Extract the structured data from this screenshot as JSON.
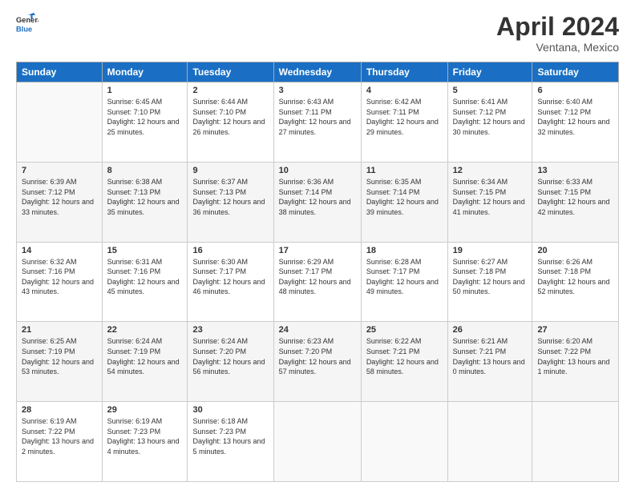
{
  "header": {
    "logo_general": "General",
    "logo_blue": "Blue",
    "month_title": "April 2024",
    "location": "Ventana, Mexico"
  },
  "weekdays": [
    "Sunday",
    "Monday",
    "Tuesday",
    "Wednesday",
    "Thursday",
    "Friday",
    "Saturday"
  ],
  "weeks": [
    [
      {
        "day": "",
        "sunrise": "",
        "sunset": "",
        "daylight": ""
      },
      {
        "day": "1",
        "sunrise": "Sunrise: 6:45 AM",
        "sunset": "Sunset: 7:10 PM",
        "daylight": "Daylight: 12 hours and 25 minutes."
      },
      {
        "day": "2",
        "sunrise": "Sunrise: 6:44 AM",
        "sunset": "Sunset: 7:10 PM",
        "daylight": "Daylight: 12 hours and 26 minutes."
      },
      {
        "day": "3",
        "sunrise": "Sunrise: 6:43 AM",
        "sunset": "Sunset: 7:11 PM",
        "daylight": "Daylight: 12 hours and 27 minutes."
      },
      {
        "day": "4",
        "sunrise": "Sunrise: 6:42 AM",
        "sunset": "Sunset: 7:11 PM",
        "daylight": "Daylight: 12 hours and 29 minutes."
      },
      {
        "day": "5",
        "sunrise": "Sunrise: 6:41 AM",
        "sunset": "Sunset: 7:12 PM",
        "daylight": "Daylight: 12 hours and 30 minutes."
      },
      {
        "day": "6",
        "sunrise": "Sunrise: 6:40 AM",
        "sunset": "Sunset: 7:12 PM",
        "daylight": "Daylight: 12 hours and 32 minutes."
      }
    ],
    [
      {
        "day": "7",
        "sunrise": "Sunrise: 6:39 AM",
        "sunset": "Sunset: 7:12 PM",
        "daylight": "Daylight: 12 hours and 33 minutes."
      },
      {
        "day": "8",
        "sunrise": "Sunrise: 6:38 AM",
        "sunset": "Sunset: 7:13 PM",
        "daylight": "Daylight: 12 hours and 35 minutes."
      },
      {
        "day": "9",
        "sunrise": "Sunrise: 6:37 AM",
        "sunset": "Sunset: 7:13 PM",
        "daylight": "Daylight: 12 hours and 36 minutes."
      },
      {
        "day": "10",
        "sunrise": "Sunrise: 6:36 AM",
        "sunset": "Sunset: 7:14 PM",
        "daylight": "Daylight: 12 hours and 38 minutes."
      },
      {
        "day": "11",
        "sunrise": "Sunrise: 6:35 AM",
        "sunset": "Sunset: 7:14 PM",
        "daylight": "Daylight: 12 hours and 39 minutes."
      },
      {
        "day": "12",
        "sunrise": "Sunrise: 6:34 AM",
        "sunset": "Sunset: 7:15 PM",
        "daylight": "Daylight: 12 hours and 41 minutes."
      },
      {
        "day": "13",
        "sunrise": "Sunrise: 6:33 AM",
        "sunset": "Sunset: 7:15 PM",
        "daylight": "Daylight: 12 hours and 42 minutes."
      }
    ],
    [
      {
        "day": "14",
        "sunrise": "Sunrise: 6:32 AM",
        "sunset": "Sunset: 7:16 PM",
        "daylight": "Daylight: 12 hours and 43 minutes."
      },
      {
        "day": "15",
        "sunrise": "Sunrise: 6:31 AM",
        "sunset": "Sunset: 7:16 PM",
        "daylight": "Daylight: 12 hours and 45 minutes."
      },
      {
        "day": "16",
        "sunrise": "Sunrise: 6:30 AM",
        "sunset": "Sunset: 7:17 PM",
        "daylight": "Daylight: 12 hours and 46 minutes."
      },
      {
        "day": "17",
        "sunrise": "Sunrise: 6:29 AM",
        "sunset": "Sunset: 7:17 PM",
        "daylight": "Daylight: 12 hours and 48 minutes."
      },
      {
        "day": "18",
        "sunrise": "Sunrise: 6:28 AM",
        "sunset": "Sunset: 7:17 PM",
        "daylight": "Daylight: 12 hours and 49 minutes."
      },
      {
        "day": "19",
        "sunrise": "Sunrise: 6:27 AM",
        "sunset": "Sunset: 7:18 PM",
        "daylight": "Daylight: 12 hours and 50 minutes."
      },
      {
        "day": "20",
        "sunrise": "Sunrise: 6:26 AM",
        "sunset": "Sunset: 7:18 PM",
        "daylight": "Daylight: 12 hours and 52 minutes."
      }
    ],
    [
      {
        "day": "21",
        "sunrise": "Sunrise: 6:25 AM",
        "sunset": "Sunset: 7:19 PM",
        "daylight": "Daylight: 12 hours and 53 minutes."
      },
      {
        "day": "22",
        "sunrise": "Sunrise: 6:24 AM",
        "sunset": "Sunset: 7:19 PM",
        "daylight": "Daylight: 12 hours and 54 minutes."
      },
      {
        "day": "23",
        "sunrise": "Sunrise: 6:24 AM",
        "sunset": "Sunset: 7:20 PM",
        "daylight": "Daylight: 12 hours and 56 minutes."
      },
      {
        "day": "24",
        "sunrise": "Sunrise: 6:23 AM",
        "sunset": "Sunset: 7:20 PM",
        "daylight": "Daylight: 12 hours and 57 minutes."
      },
      {
        "day": "25",
        "sunrise": "Sunrise: 6:22 AM",
        "sunset": "Sunset: 7:21 PM",
        "daylight": "Daylight: 12 hours and 58 minutes."
      },
      {
        "day": "26",
        "sunrise": "Sunrise: 6:21 AM",
        "sunset": "Sunset: 7:21 PM",
        "daylight": "Daylight: 13 hours and 0 minutes."
      },
      {
        "day": "27",
        "sunrise": "Sunrise: 6:20 AM",
        "sunset": "Sunset: 7:22 PM",
        "daylight": "Daylight: 13 hours and 1 minute."
      }
    ],
    [
      {
        "day": "28",
        "sunrise": "Sunrise: 6:19 AM",
        "sunset": "Sunset: 7:22 PM",
        "daylight": "Daylight: 13 hours and 2 minutes."
      },
      {
        "day": "29",
        "sunrise": "Sunrise: 6:19 AM",
        "sunset": "Sunset: 7:23 PM",
        "daylight": "Daylight: 13 hours and 4 minutes."
      },
      {
        "day": "30",
        "sunrise": "Sunrise: 6:18 AM",
        "sunset": "Sunset: 7:23 PM",
        "daylight": "Daylight: 13 hours and 5 minutes."
      },
      {
        "day": "",
        "sunrise": "",
        "sunset": "",
        "daylight": ""
      },
      {
        "day": "",
        "sunrise": "",
        "sunset": "",
        "daylight": ""
      },
      {
        "day": "",
        "sunrise": "",
        "sunset": "",
        "daylight": ""
      },
      {
        "day": "",
        "sunrise": "",
        "sunset": "",
        "daylight": ""
      }
    ]
  ]
}
